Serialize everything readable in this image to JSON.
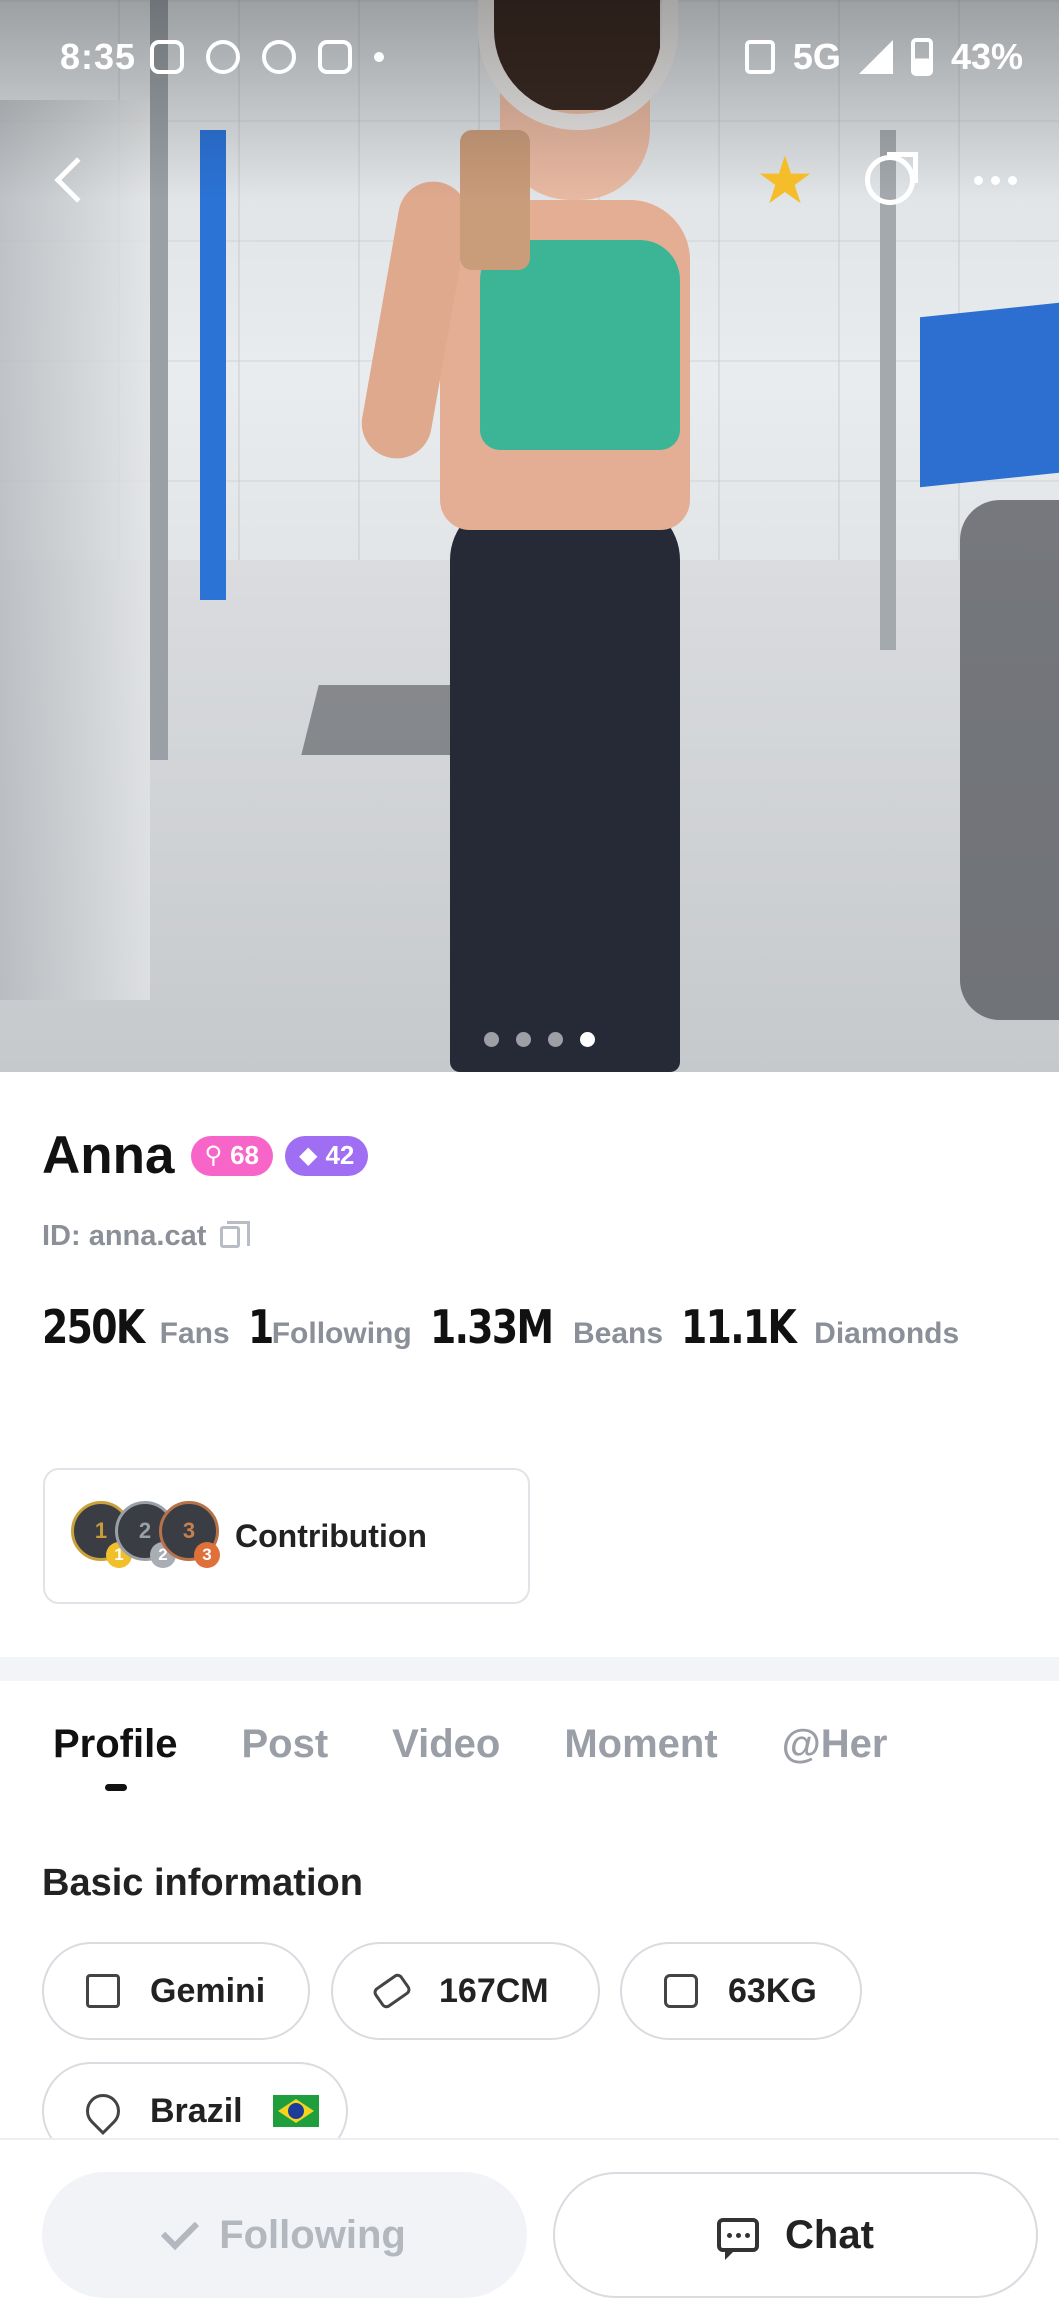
{
  "status_bar": {
    "time": "8:35",
    "network": "5G",
    "battery": "43%",
    "icons": [
      "instagram-icon",
      "call-icon",
      "voicemail-icon",
      "messenger-icon",
      "vibrate-icon",
      "signal-icon",
      "battery-icon"
    ]
  },
  "hero": {
    "photo_count": 4,
    "active_photo_index": 3,
    "favorite_color": "#f6bd2b"
  },
  "profile": {
    "name": "Anna",
    "level_badge": "68",
    "diamond_badge": "42",
    "id_text": "ID: anna.cat",
    "stats": [
      {
        "value": "250K",
        "label": "Fans"
      },
      {
        "value": "1",
        "label": "Following"
      },
      {
        "value": "1.33M",
        "label": "Beans"
      },
      {
        "value": "11.1K",
        "label": "Diamonds"
      }
    ],
    "contribution_label": "Contribution",
    "medals": [
      "1",
      "2",
      "3"
    ]
  },
  "tabs": [
    {
      "label": "Profile",
      "active": true
    },
    {
      "label": "Post",
      "active": false
    },
    {
      "label": "Video",
      "active": false
    },
    {
      "label": "Moment",
      "active": false
    },
    {
      "label": "@Her",
      "active": false
    }
  ],
  "basic_info": {
    "title": "Basic information",
    "zodiac": "Gemini",
    "height": "167CM",
    "weight": "63KG",
    "country": "Brazil"
  },
  "actions": {
    "following_label": "Following",
    "chat_label": "Chat"
  },
  "colors": {
    "pink_badge": "#f765c8",
    "purple_badge": "#9f6ef2"
  }
}
